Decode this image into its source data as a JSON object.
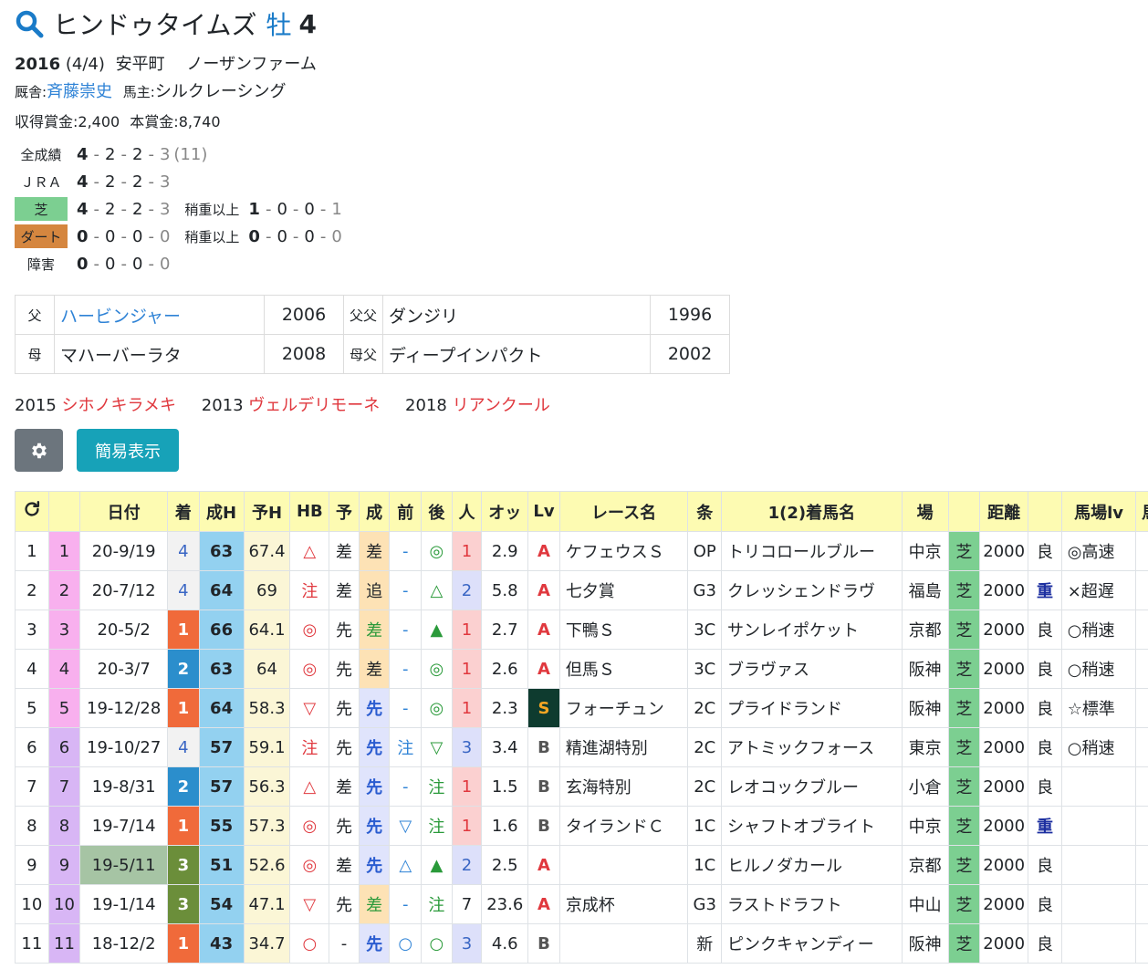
{
  "horse": {
    "name": "ヒンドゥタイムズ",
    "sex": "牡",
    "age": "4",
    "birth_year": "2016",
    "birth_date": "(4/4)",
    "birthplace": "安平町",
    "breeder": "ノーザンファーム",
    "trainer_label": "厩舎:",
    "trainer": "斉藤崇史",
    "owner_label": "馬主:",
    "owner": "シルクレーシング",
    "prize_earned": "収得賞金:2,400",
    "prize_main": "本賞金:8,740"
  },
  "records": [
    {
      "label": "全成績",
      "v": [
        "4",
        "2",
        "2",
        "3"
      ],
      "extra": "(11)"
    },
    {
      "label": "ＪＲＡ",
      "v": [
        "4",
        "2",
        "2",
        "3"
      ]
    },
    {
      "label": "芝",
      "v": [
        "4",
        "2",
        "2",
        "3"
      ],
      "sub_label": "稍重以上",
      "sub": [
        "1",
        "0",
        "0",
        "1"
      ]
    },
    {
      "label": "ダート",
      "v": [
        "0",
        "0",
        "0",
        "0"
      ],
      "sub_label": "稍重以上",
      "sub": [
        "0",
        "0",
        "0",
        "0"
      ]
    },
    {
      "label": "障害",
      "v": [
        "0",
        "0",
        "0",
        "0"
      ]
    }
  ],
  "pedigree": {
    "sire_label": "父",
    "sire": "ハービンジャー",
    "sire_year": "2006",
    "sire_sire_label": "父父",
    "sire_sire": "ダンジリ",
    "sire_sire_year": "1996",
    "dam_label": "母",
    "dam": "マハーバーラタ",
    "dam_year": "2008",
    "dam_sire_label": "母父",
    "dam_sire": "ディープインパクト",
    "dam_sire_year": "2002"
  },
  "siblings": [
    {
      "year": "2015",
      "name": "シホノキラメキ"
    },
    {
      "year": "2013",
      "name": "ヴェルデリモーネ"
    },
    {
      "year": "2018",
      "name": "リアンクール"
    }
  ],
  "buttons": {
    "simple": "簡易表示",
    "settings_icon": "gear-icon",
    "reload_icon": "reload-icon"
  },
  "table": {
    "headers": [
      "",
      "",
      "日付",
      "着",
      "成H",
      "予H",
      "HB",
      "予",
      "成",
      "前",
      "後",
      "人",
      "オッ",
      "Lv",
      "レース名",
      "条",
      "1(2)着馬名",
      "場",
      "",
      "距離",
      "",
      "馬場lv",
      "馬"
    ],
    "rows": [
      {
        "idx": "1",
        "gate": "1",
        "date": "20-9/19",
        "place": "4",
        "h": "63",
        "ph": "67.4",
        "hb": "△",
        "yo": "差",
        "sei": "差",
        "mae": "-",
        "ato": "◎",
        "pop": "1",
        "odds": "2.9",
        "lv": "A",
        "race": "ケフェウスＳ",
        "cls": "OP",
        "winner": "トリコロールブルー",
        "course": "中京",
        "surface": "芝",
        "dist": "2000",
        "going": "良",
        "baba": "◎高速"
      },
      {
        "idx": "2",
        "gate": "2",
        "date": "20-7/12",
        "place": "4",
        "h": "64",
        "ph": "69",
        "hb": "注",
        "yo": "差",
        "sei": "追",
        "mae": "-",
        "ato": "△",
        "pop": "2",
        "odds": "5.8",
        "lv": "A",
        "race": "七夕賞",
        "cls": "G3",
        "winner": "クレッシェンドラヴ",
        "course": "福島",
        "surface": "芝",
        "dist": "2000",
        "going": "重",
        "baba": "×超遅"
      },
      {
        "idx": "3",
        "gate": "3",
        "date": "20-5/2",
        "place": "1",
        "h": "66",
        "ph": "64.1",
        "hb": "◎",
        "yo": "先",
        "sei": "差",
        "mae": "-",
        "ato": "▲",
        "pop": "1",
        "odds": "2.7",
        "lv": "A",
        "race": "下鴨Ｓ",
        "cls": "3C",
        "winner": "サンレイポケット",
        "course": "京都",
        "surface": "芝",
        "dist": "2000",
        "going": "良",
        "baba": "○稍速"
      },
      {
        "idx": "4",
        "gate": "4",
        "date": "20-3/7",
        "place": "2",
        "h": "63",
        "ph": "64",
        "hb": "◎",
        "yo": "先",
        "sei": "差",
        "mae": "-",
        "ato": "◎",
        "pop": "1",
        "odds": "2.6",
        "lv": "A",
        "race": "但馬Ｓ",
        "cls": "3C",
        "winner": "ブラヴァス",
        "course": "阪神",
        "surface": "芝",
        "dist": "2000",
        "going": "良",
        "baba": "○稍速"
      },
      {
        "idx": "5",
        "gate": "5",
        "date": "19-12/28",
        "place": "1",
        "h": "64",
        "ph": "58.3",
        "hb": "▽",
        "yo": "先",
        "sei": "先",
        "mae": "-",
        "ato": "◎",
        "pop": "1",
        "odds": "2.3",
        "lv": "S",
        "race": "フォーチュン",
        "cls": "2C",
        "winner": "プライドランド",
        "course": "阪神",
        "surface": "芝",
        "dist": "2000",
        "going": "良",
        "baba": "☆標準"
      },
      {
        "idx": "6",
        "gate": "6",
        "date": "19-10/27",
        "place": "4",
        "h": "57",
        "ph": "59.1",
        "hb": "注",
        "yo": "先",
        "sei": "先",
        "mae": "注",
        "ato": "▽",
        "pop": "3",
        "odds": "3.4",
        "lv": "B",
        "race": "精進湖特別",
        "cls": "2C",
        "winner": "アトミックフォース",
        "course": "東京",
        "surface": "芝",
        "dist": "2000",
        "going": "良",
        "baba": "○稍速"
      },
      {
        "idx": "7",
        "gate": "7",
        "date": "19-8/31",
        "place": "2",
        "h": "57",
        "ph": "56.3",
        "hb": "△",
        "yo": "差",
        "sei": "先",
        "mae": "-",
        "ato": "注",
        "pop": "1",
        "odds": "1.5",
        "lv": "B",
        "race": "玄海特別",
        "cls": "2C",
        "winner": "レオコックブルー",
        "course": "小倉",
        "surface": "芝",
        "dist": "2000",
        "going": "良",
        "baba": ""
      },
      {
        "idx": "8",
        "gate": "8",
        "date": "19-7/14",
        "place": "1",
        "h": "55",
        "ph": "57.3",
        "hb": "◎",
        "yo": "先",
        "sei": "先",
        "mae": "▽",
        "ato": "注",
        "pop": "1",
        "odds": "1.6",
        "lv": "B",
        "race": "タイランドＣ",
        "cls": "1C",
        "winner": "シャフトオブライト",
        "course": "中京",
        "surface": "芝",
        "dist": "2000",
        "going": "重",
        "baba": ""
      },
      {
        "idx": "9",
        "gate": "9",
        "date": "19-5/11",
        "place": "3",
        "h": "51",
        "ph": "52.6",
        "hb": "◎",
        "yo": "差",
        "sei": "先",
        "mae": "△",
        "ato": "▲",
        "pop": "2",
        "odds": "2.5",
        "lv": "A",
        "race": "",
        "cls": "1C",
        "winner": "ヒルノダカール",
        "course": "京都",
        "surface": "芝",
        "dist": "2000",
        "going": "良",
        "baba": ""
      },
      {
        "idx": "10",
        "gate": "10",
        "date": "19-1/14",
        "place": "3",
        "h": "54",
        "ph": "47.1",
        "hb": "▽",
        "yo": "先",
        "sei": "差",
        "mae": "-",
        "ato": "注",
        "pop": "7",
        "odds": "23.6",
        "lv": "A",
        "race": "京成杯",
        "cls": "G3",
        "winner": "ラストドラフト",
        "course": "中山",
        "surface": "芝",
        "dist": "2000",
        "going": "良",
        "baba": ""
      },
      {
        "idx": "11",
        "gate": "11",
        "date": "18-12/2",
        "place": "1",
        "h": "43",
        "ph": "34.7",
        "hb": "○",
        "yo": "-",
        "sei": "先",
        "mae": "○",
        "ato": "○",
        "pop": "3",
        "odds": "4.6",
        "lv": "B",
        "race": "",
        "cls": "新",
        "winner": "ピンクキャンディー",
        "course": "阪神",
        "surface": "芝",
        "dist": "2000",
        "going": "良",
        "baba": ""
      }
    ]
  }
}
